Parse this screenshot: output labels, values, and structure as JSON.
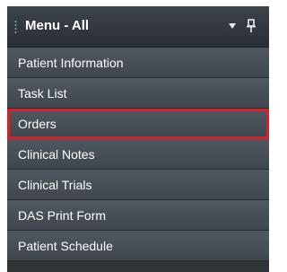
{
  "menu": {
    "title": "Menu - All",
    "header_icons": [
      "chevron-down-icon",
      "pin-icon"
    ],
    "highlight_color": "#d42026",
    "items": [
      {
        "label": "Patient Information"
      },
      {
        "label": "Task List"
      },
      {
        "label": "Orders",
        "highlighted": true
      },
      {
        "label": "Clinical Notes"
      },
      {
        "label": "Clinical Trials"
      },
      {
        "label": "DAS Print Form"
      },
      {
        "label": "Patient Schedule"
      }
    ]
  }
}
